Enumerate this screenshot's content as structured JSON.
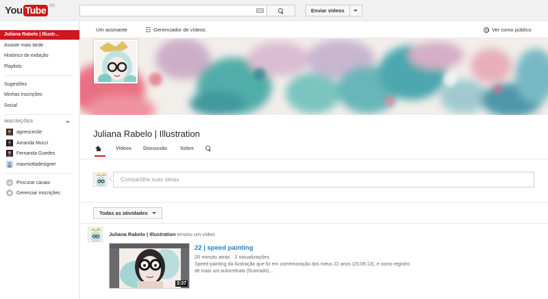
{
  "header": {
    "logo_you": "You",
    "logo_tube": "Tube",
    "logo_region": "BR",
    "search_placeholder": "",
    "upload_label": "Enviar vídeos"
  },
  "sidebar": {
    "items": [
      {
        "label": "Juliana Rabelo | Illustr...",
        "active": true
      },
      {
        "label": "Assistir mais tarde"
      },
      {
        "label": "Histórico de exibição"
      },
      {
        "label": "Playlists"
      },
      {
        "label": "Sugestões"
      },
      {
        "label": "Minhas inscrições"
      },
      {
        "label": "Social"
      }
    ],
    "subscriptions_heading": "INSCRIÇÕES",
    "subscriptions": [
      {
        "label": "agnescecile"
      },
      {
        "label": "Amanda Mocci"
      },
      {
        "label": "Fernanda Guedes"
      },
      {
        "label": "maxmottadesigner"
      }
    ],
    "browse_channels": "Procurar canais",
    "manage_subscriptions": "Gerenciar inscrições"
  },
  "channel_nav": {
    "subscriber": "Um assinante",
    "video_manager": "Gerenciador de vídeos",
    "view_as_public": "Ver como público"
  },
  "channel": {
    "title": "Juliana Rabelo | Illustration",
    "tabs": [
      "Vídeos",
      "Discussão",
      "Sobre"
    ]
  },
  "share": {
    "placeholder": "Compartilhe suas ideias"
  },
  "activity": {
    "filter_label": "Todas as atividades"
  },
  "feed": {
    "author": "Juliana Rabelo | Illustration",
    "action": "enviou um vídeo",
    "video_title": "22 | speed painting",
    "video_meta": "20 minuto atrás · 2 visualizações",
    "video_desc": "Speed painting da ilustração que fiz em comemoração dos meus 22 anos (20.09.13), e como registro de mais um autorretrato (frustrado)...",
    "duration": "3:37"
  },
  "colors": {
    "brand_red": "#cc181e",
    "link_blue": "#1b7fcc"
  }
}
